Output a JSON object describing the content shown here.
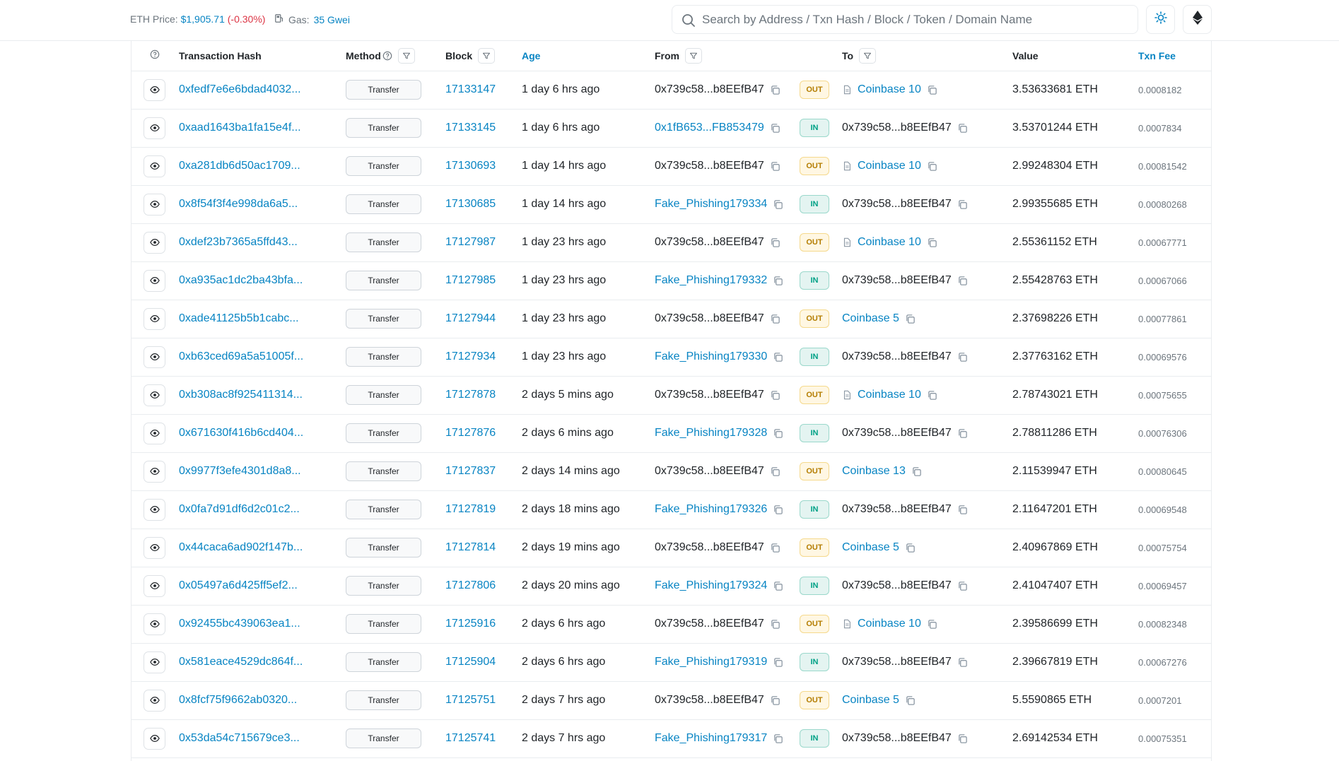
{
  "header": {
    "eth_price_label": "ETH Price:",
    "eth_price_value": "$1,905.71",
    "eth_price_change": "(-0.30%)",
    "gas_label": "Gas:",
    "gas_value": "35 Gwei",
    "search_placeholder": "Search by Address / Txn Hash / Block / Token / Domain Name"
  },
  "columns": {
    "hash": "Transaction Hash",
    "method": "Method",
    "block": "Block",
    "age": "Age",
    "from": "From",
    "to": "To",
    "value": "Value",
    "fee": "Txn Fee"
  },
  "rows": [
    {
      "hash": "0xfedf7e6e6bdad4032...",
      "method": "Transfer",
      "block": "17133147",
      "age": "1 day 6 hrs ago",
      "from": "0x739c58...b8EEfB47",
      "from_link": false,
      "dir": "OUT",
      "to": "Coinbase 10",
      "to_link": true,
      "to_contract": true,
      "value": "3.53633681 ETH",
      "fee": "0.0008182"
    },
    {
      "hash": "0xaad1643ba1fa15e4f...",
      "method": "Transfer",
      "block": "17133145",
      "age": "1 day 6 hrs ago",
      "from": "0x1fB653...FB853479",
      "from_link": true,
      "dir": "IN",
      "to": "0x739c58...b8EEfB47",
      "to_link": false,
      "to_contract": false,
      "value": "3.53701244 ETH",
      "fee": "0.0007834"
    },
    {
      "hash": "0xa281db6d50ac1709...",
      "method": "Transfer",
      "block": "17130693",
      "age": "1 day 14 hrs ago",
      "from": "0x739c58...b8EEfB47",
      "from_link": false,
      "dir": "OUT",
      "to": "Coinbase 10",
      "to_link": true,
      "to_contract": true,
      "value": "2.99248304 ETH",
      "fee": "0.00081542"
    },
    {
      "hash": "0x8f54f3f4e998da6a5...",
      "method": "Transfer",
      "block": "17130685",
      "age": "1 day 14 hrs ago",
      "from": "Fake_Phishing179334",
      "from_link": true,
      "dir": "IN",
      "to": "0x739c58...b8EEfB47",
      "to_link": false,
      "to_contract": false,
      "value": "2.99355685 ETH",
      "fee": "0.00080268"
    },
    {
      "hash": "0xdef23b7365a5ffd43...",
      "method": "Transfer",
      "block": "17127987",
      "age": "1 day 23 hrs ago",
      "from": "0x739c58...b8EEfB47",
      "from_link": false,
      "dir": "OUT",
      "to": "Coinbase 10",
      "to_link": true,
      "to_contract": true,
      "value": "2.55361152 ETH",
      "fee": "0.00067771"
    },
    {
      "hash": "0xa935ac1dc2ba43bfa...",
      "method": "Transfer",
      "block": "17127985",
      "age": "1 day 23 hrs ago",
      "from": "Fake_Phishing179332",
      "from_link": true,
      "dir": "IN",
      "to": "0x739c58...b8EEfB47",
      "to_link": false,
      "to_contract": false,
      "value": "2.55428763 ETH",
      "fee": "0.00067066"
    },
    {
      "hash": "0xade41125b5b1cabc...",
      "method": "Transfer",
      "block": "17127944",
      "age": "1 day 23 hrs ago",
      "from": "0x739c58...b8EEfB47",
      "from_link": false,
      "dir": "OUT",
      "to": "Coinbase 5",
      "to_link": true,
      "to_contract": false,
      "value": "2.37698226 ETH",
      "fee": "0.00077861"
    },
    {
      "hash": "0xb63ced69a5a51005f...",
      "method": "Transfer",
      "block": "17127934",
      "age": "1 day 23 hrs ago",
      "from": "Fake_Phishing179330",
      "from_link": true,
      "dir": "IN",
      "to": "0x739c58...b8EEfB47",
      "to_link": false,
      "to_contract": false,
      "value": "2.37763162 ETH",
      "fee": "0.00069576"
    },
    {
      "hash": "0xb308ac8f925411314...",
      "method": "Transfer",
      "block": "17127878",
      "age": "2 days 5 mins ago",
      "from": "0x739c58...b8EEfB47",
      "from_link": false,
      "dir": "OUT",
      "to": "Coinbase 10",
      "to_link": true,
      "to_contract": true,
      "value": "2.78743021 ETH",
      "fee": "0.00075655"
    },
    {
      "hash": "0x671630f416b6cd404...",
      "method": "Transfer",
      "block": "17127876",
      "age": "2 days 6 mins ago",
      "from": "Fake_Phishing179328",
      "from_link": true,
      "dir": "IN",
      "to": "0x739c58...b8EEfB47",
      "to_link": false,
      "to_contract": false,
      "value": "2.78811286 ETH",
      "fee": "0.00076306"
    },
    {
      "hash": "0x9977f3efe4301d8a8...",
      "method": "Transfer",
      "block": "17127837",
      "age": "2 days 14 mins ago",
      "from": "0x739c58...b8EEfB47",
      "from_link": false,
      "dir": "OUT",
      "to": "Coinbase 13",
      "to_link": true,
      "to_contract": false,
      "value": "2.11539947 ETH",
      "fee": "0.00080645"
    },
    {
      "hash": "0x0fa7d91df6d2c01c2...",
      "method": "Transfer",
      "block": "17127819",
      "age": "2 days 18 mins ago",
      "from": "Fake_Phishing179326",
      "from_link": true,
      "dir": "IN",
      "to": "0x739c58...b8EEfB47",
      "to_link": false,
      "to_contract": false,
      "value": "2.11647201 ETH",
      "fee": "0.00069548"
    },
    {
      "hash": "0x44caca6ad902f147b...",
      "method": "Transfer",
      "block": "17127814",
      "age": "2 days 19 mins ago",
      "from": "0x739c58...b8EEfB47",
      "from_link": false,
      "dir": "OUT",
      "to": "Coinbase 5",
      "to_link": true,
      "to_contract": false,
      "value": "2.40967869 ETH",
      "fee": "0.00075754"
    },
    {
      "hash": "0x05497a6d425ff5ef2...",
      "method": "Transfer",
      "block": "17127806",
      "age": "2 days 20 mins ago",
      "from": "Fake_Phishing179324",
      "from_link": true,
      "dir": "IN",
      "to": "0x739c58...b8EEfB47",
      "to_link": false,
      "to_contract": false,
      "value": "2.41047407 ETH",
      "fee": "0.00069457"
    },
    {
      "hash": "0x92455bc439063ea1...",
      "method": "Transfer",
      "block": "17125916",
      "age": "2 days 6 hrs ago",
      "from": "0x739c58...b8EEfB47",
      "from_link": false,
      "dir": "OUT",
      "to": "Coinbase 10",
      "to_link": true,
      "to_contract": true,
      "value": "2.39586699 ETH",
      "fee": "0.00082348"
    },
    {
      "hash": "0x581eace4529dc864f...",
      "method": "Transfer",
      "block": "17125904",
      "age": "2 days 6 hrs ago",
      "from": "Fake_Phishing179319",
      "from_link": true,
      "dir": "IN",
      "to": "0x739c58...b8EEfB47",
      "to_link": false,
      "to_contract": false,
      "value": "2.39667819 ETH",
      "fee": "0.00067276"
    },
    {
      "hash": "0x8fcf75f9662ab0320...",
      "method": "Transfer",
      "block": "17125751",
      "age": "2 days 7 hrs ago",
      "from": "0x739c58...b8EEfB47",
      "from_link": false,
      "dir": "OUT",
      "to": "Coinbase 5",
      "to_link": true,
      "to_contract": false,
      "value": "5.5590865 ETH",
      "fee": "0.0007201"
    },
    {
      "hash": "0x53da54c715679ce3...",
      "method": "Transfer",
      "block": "17125741",
      "age": "2 days 7 hrs ago",
      "from": "Fake_Phishing179317",
      "from_link": true,
      "dir": "IN",
      "to": "0x739c58...b8EEfB47",
      "to_link": false,
      "to_contract": false,
      "value": "2.69142534 ETH",
      "fee": "0.00075351"
    }
  ]
}
